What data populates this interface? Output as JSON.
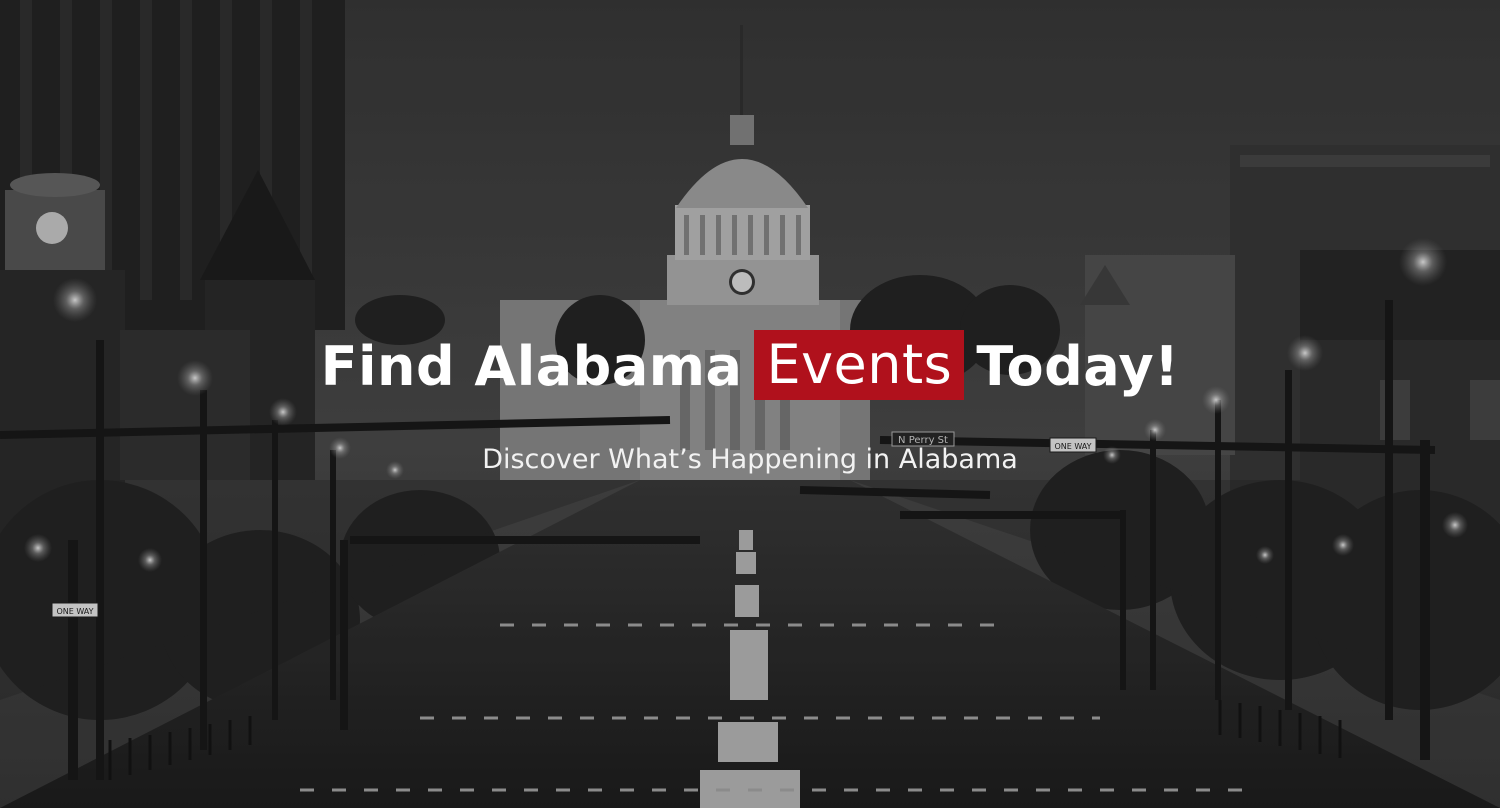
{
  "hero": {
    "title_before": "Find Alabama",
    "title_highlight": "Events",
    "title_after": "Today!",
    "subtitle": "Discover What’s Happening in Alabama",
    "highlight_color": "#b0111c",
    "background_image": "grayscale dusk street view toward a domed capitol building"
  },
  "scene_signs": {
    "street_sign": "N Perry St",
    "one_way_left": "ONE WAY",
    "one_way_right": "ONE WAY"
  }
}
